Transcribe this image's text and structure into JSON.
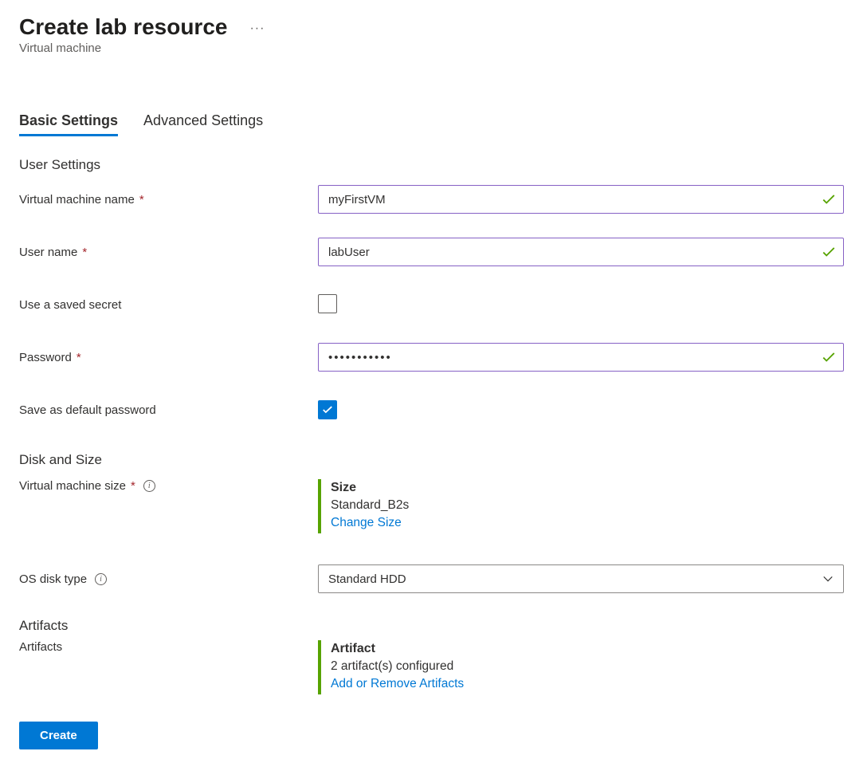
{
  "header": {
    "title": "Create lab resource",
    "subtitle": "Virtual machine"
  },
  "tabs": {
    "basic": "Basic Settings",
    "advanced": "Advanced Settings"
  },
  "sections": {
    "user_settings": "User Settings",
    "disk_and_size": "Disk and Size",
    "artifacts": "Artifacts"
  },
  "form": {
    "vm_name": {
      "label": "Virtual machine name",
      "value": "myFirstVM"
    },
    "user_name": {
      "label": "User name",
      "value": "labUser"
    },
    "use_saved_secret": {
      "label": "Use a saved secret",
      "checked": false
    },
    "password": {
      "label": "Password",
      "value": "•••••••••••"
    },
    "save_default_password": {
      "label": "Save as default password",
      "checked": true
    },
    "vm_size": {
      "label": "Virtual machine size",
      "card_title": "Size",
      "card_value": "Standard_B2s",
      "card_link": "Change Size"
    },
    "os_disk_type": {
      "label": "OS disk type",
      "value": "Standard HDD"
    },
    "artifacts": {
      "label": "Artifacts",
      "card_title": "Artifact",
      "card_value": "2 artifact(s) configured",
      "card_link": "Add or Remove Artifacts"
    }
  },
  "buttons": {
    "create": "Create"
  }
}
